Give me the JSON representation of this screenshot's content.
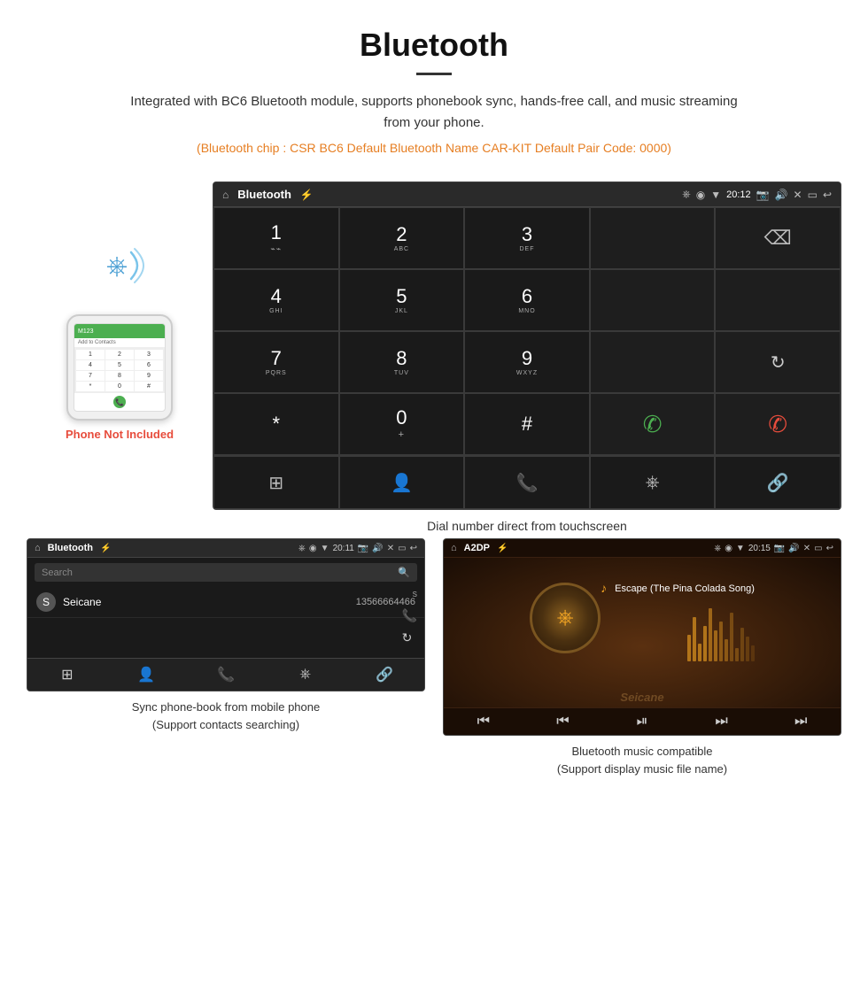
{
  "page": {
    "title": "Bluetooth",
    "description": "Integrated with BC6 Bluetooth module, supports phonebook sync, hands-free call, and music streaming from your phone.",
    "specs": "(Bluetooth chip : CSR BC6   Default Bluetooth Name CAR-KIT    Default Pair Code: 0000)",
    "dialer_caption": "Dial number direct from touchscreen",
    "phonebook_caption_line1": "Sync phone-book from mobile phone",
    "phonebook_caption_line2": "(Support contacts searching)",
    "music_caption_line1": "Bluetooth music compatible",
    "music_caption_line2": "(Support display music file name)"
  },
  "phone": {
    "not_included_label": "Phone Not Included",
    "top_bar_text": "M123",
    "contacts_label": "Add to Contacts"
  },
  "dialer_screen": {
    "header_title": "Bluetooth",
    "header_time": "20:12",
    "keys": [
      {
        "main": "1",
        "sub": ""
      },
      {
        "main": "2",
        "sub": "ABC"
      },
      {
        "main": "3",
        "sub": "DEF"
      },
      {
        "main": "",
        "sub": ""
      },
      {
        "main": "⌫",
        "sub": ""
      },
      {
        "main": "4",
        "sub": "GHI"
      },
      {
        "main": "5",
        "sub": "JKL"
      },
      {
        "main": "6",
        "sub": "MNO"
      },
      {
        "main": "",
        "sub": ""
      },
      {
        "main": "",
        "sub": ""
      },
      {
        "main": "7",
        "sub": "PQRS"
      },
      {
        "main": "8",
        "sub": "TUV"
      },
      {
        "main": "9",
        "sub": "WXYZ"
      },
      {
        "main": "",
        "sub": ""
      },
      {
        "main": "↻",
        "sub": ""
      },
      {
        "main": "*",
        "sub": ""
      },
      {
        "main": "0",
        "sub": "+"
      },
      {
        "main": "#",
        "sub": ""
      },
      {
        "main": "📞",
        "sub": ""
      },
      {
        "main": "📵",
        "sub": ""
      }
    ],
    "bottom_icons": [
      "⊞",
      "👤",
      "📞",
      "✱",
      "🔗"
    ]
  },
  "phonebook_screen": {
    "header_title": "Bluetooth",
    "header_time": "20:11",
    "search_placeholder": "Search",
    "contacts": [
      {
        "letter": "S",
        "name": "Seicane",
        "number": "13566664466"
      }
    ],
    "bottom_icons": [
      "⊞",
      "👤",
      "📞",
      "✱",
      "🔗"
    ]
  },
  "music_screen": {
    "header_title": "A2DP",
    "header_time": "20:15",
    "song_title": "Escape (The Pina Colada Song)",
    "controls": [
      "⏮",
      "⏮",
      "⏯",
      "⏭",
      "⏭"
    ]
  },
  "colors": {
    "orange": "#e67e22",
    "red": "#e74c3c",
    "green": "#4CAF50",
    "blue": "#4a9fd4",
    "gold": "#f5a623",
    "dark_bg": "#1a1a1a",
    "header_bg": "#2a2a2a"
  }
}
